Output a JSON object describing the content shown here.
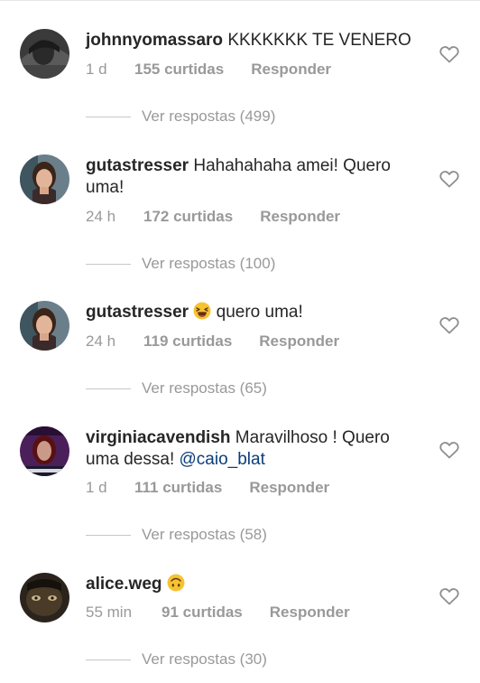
{
  "comments": [
    {
      "username": "johnnyomassaro",
      "text": " KKKKKKK TE VENERO",
      "time": "1 d",
      "likes": "155 curtidas",
      "reply": "Responder",
      "view_replies": "Ver respostas (499)"
    },
    {
      "username": "gutastresser",
      "text": " Hahahahaha amei! Quero uma!",
      "time": "24 h",
      "likes": "172 curtidas",
      "reply": "Responder",
      "view_replies": "Ver respostas (100)"
    },
    {
      "username": "gutastresser",
      "emoji": "laughing-emoji",
      "text_after": " quero uma!",
      "time": "24 h",
      "likes": "119 curtidas",
      "reply": "Responder",
      "view_replies": "Ver respostas (65)"
    },
    {
      "username": "virginiacavendish",
      "text": " Maravilhoso ! Quero uma dessa! ",
      "mention": "@caio_blat",
      "time": "1 d",
      "likes": "111 curtidas",
      "reply": "Responder",
      "view_replies": "Ver respostas (58)"
    },
    {
      "username": "alice.weg",
      "emoji": "upside-down-face-emoji",
      "time": "55 min",
      "likes": "91 curtidas",
      "reply": "Responder",
      "view_replies": "Ver respostas (30)"
    }
  ],
  "icons": {
    "like": "heart-outline-icon"
  },
  "colors": {
    "text": "#262626",
    "secondary": "#999999",
    "mention": "#0a3d7a",
    "divider": "#c7c7c7"
  }
}
